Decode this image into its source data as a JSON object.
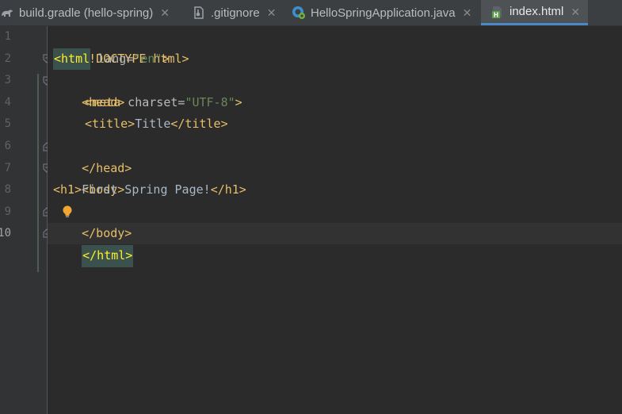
{
  "tabs": [
    {
      "label": "build.gradle (hello-spring)",
      "icon": "gradle-icon",
      "active": false
    },
    {
      "label": ".gitignore",
      "icon": "gitignore-file-icon",
      "active": false
    },
    {
      "label": "HelloSpringApplication.java",
      "icon": "spring-boot-class-icon",
      "active": false
    },
    {
      "label": "index.html",
      "icon": "html-file-icon",
      "active": true
    }
  ],
  "editor": {
    "line_numbers": [
      "1",
      "2",
      "3",
      "4",
      "5",
      "6",
      "7",
      "8",
      "9",
      "10"
    ],
    "current_line": "10",
    "code": {
      "l1": "<!DOCTYPE html>",
      "l2_open": "<html",
      "l2_attr": " lang=",
      "l2_val": "\"en\"",
      "l2_close": ">",
      "l3": "<head>",
      "l4_open": "<meta",
      "l4_attr": " charset=",
      "l4_val": "\"UTF-8\"",
      "l4_close": ">",
      "l5_open": "<title>",
      "l5_text": "Title",
      "l5_close": "</title>",
      "l6": "</head>",
      "l7": "<body>",
      "l8_open": "<h1>",
      "l8_text": "First Spring Page!",
      "l8_close": "</h1>",
      "l9": "</body>",
      "l10": "</html>"
    }
  },
  "colors": {
    "tag": "#e8bf6a",
    "string": "#6a8759",
    "attribute": "#bababa",
    "text": "#a9b7c6",
    "background": "#2b2b2b",
    "gutter": "#313335",
    "tab_underline": "#4a88c7"
  }
}
